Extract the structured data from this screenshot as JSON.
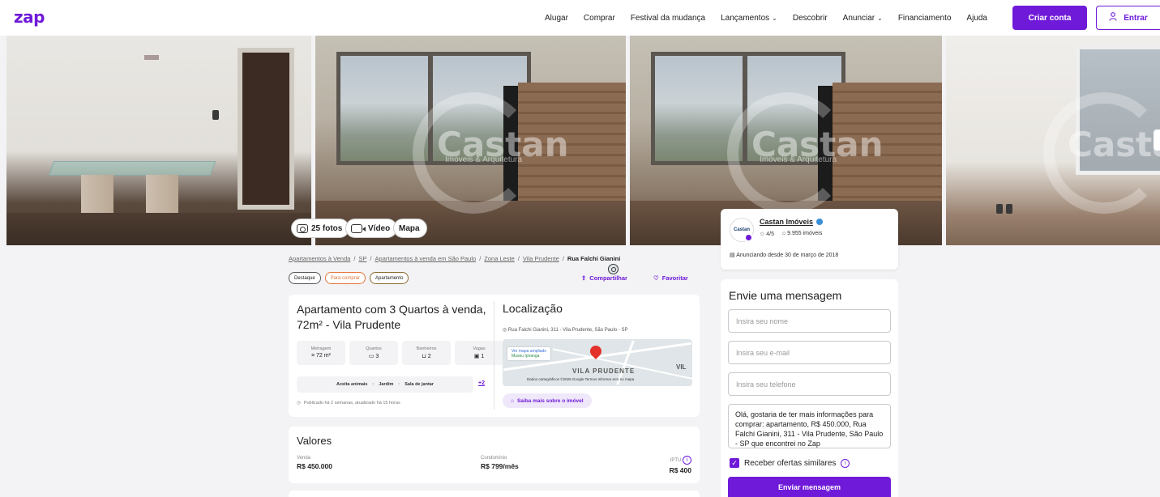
{
  "header": {
    "logo": "zap",
    "nav": [
      "Alugar",
      "Comprar",
      "Festival da mudança",
      "Lançamentos",
      "Descobrir",
      "Anunciar",
      "Financiamento",
      "Ajuda"
    ],
    "nav_dropdown_indexes": [
      3,
      5
    ],
    "create_account": "Criar conta",
    "login": "Entrar"
  },
  "gallery": {
    "watermark": "Castan",
    "watermark_sub": "Imóveis & Arquitetura",
    "photos_btn": "25 fotos",
    "video_btn": "Vídeo",
    "map_btn": "Mapa"
  },
  "advertiser": {
    "logo_text": "Castan",
    "name": "Castan Imóveis",
    "rating": "4/5",
    "listings": "9.955 imóveis",
    "since": "Anunciando desde 30 de março de 2018"
  },
  "message_form": {
    "title": "Envie uma mensagem",
    "name_placeholder": "Insira seu nome",
    "email_placeholder": "Insira seu e-mail",
    "phone_placeholder": "Insira seu telefone",
    "message": "Olá, gostaria de ter mais informações para comprar: apartamento, R$ 450.000, Rua Falchi Gianini, 311 - Vila Prudente, São Paulo - SP que encontrei no Zap",
    "similar_offers": "Receber ofertas similares",
    "send": "Enviar mensagem"
  },
  "breadcrumb": {
    "items": [
      "Apartamentos à Venda",
      "SP",
      "Apartamentos à venda em São Paulo",
      "Zona Leste",
      "Vila Prudente"
    ],
    "current": "Rua Falchi Gianini"
  },
  "tags": [
    "Destaque",
    "Para comprar",
    "Apartamento"
  ],
  "actions": {
    "share": "Compartilhar",
    "favorite": "Favoritar"
  },
  "listing": {
    "title": "Apartamento com 3 Quartos à venda, 72m² - Vila Prudente",
    "features": [
      {
        "label": "Metragem",
        "value": "72 m²"
      },
      {
        "label": "Quartos",
        "value": "3"
      },
      {
        "label": "Banheiros",
        "value": "2"
      },
      {
        "label": "Vagas",
        "value": "1"
      }
    ],
    "amenities": [
      "Aceita animais",
      "Jardim",
      "Sala de jantar"
    ],
    "more_amenities": "+2",
    "published": "Publicado há 2 semanas, atualizado há 15 horas"
  },
  "location": {
    "title": "Localização",
    "address": "Rua Falchi Gianini, 311 - Vila Prudente, São Paulo - SP",
    "map_badge": "Ver mapa ampliado",
    "map_area_label": "VILA PRUDENTE",
    "map_area_label_right": "VIL",
    "map_ipiranga": "Museu Ipiranga",
    "map_footer": "Dados cartográficos ©2025 Google   Termos   Informar erro no mapa",
    "more_button": "Saiba mais sobre o imóvel"
  },
  "values": {
    "title": "Valores",
    "sale_label": "Venda",
    "sale": "R$ 450.000",
    "condo_label": "Condomínio",
    "condo": "R$ 799/mês",
    "iptu_label": "IPTU",
    "iptu": "R$ 400"
  },
  "colors": {
    "brand": "#6f1ad8",
    "pin": "#e3302a",
    "tag_orange": "#e3743a"
  }
}
